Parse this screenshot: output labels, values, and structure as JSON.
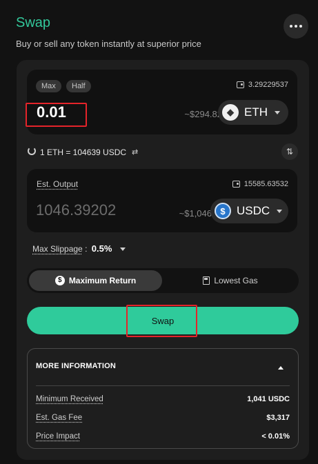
{
  "header": {
    "title": "Swap",
    "subtitle": "Buy or sell any token instantly at superior price"
  },
  "from": {
    "max_label": "Max",
    "half_label": "Half",
    "balance": "3.29229537",
    "amount": "0.01",
    "usd_value": "~$294.82",
    "token": "ETH"
  },
  "rate": {
    "text": "1 ETH = 104639 USDC"
  },
  "to": {
    "label": "Est. Output",
    "balance": "15585.63532",
    "amount": "1046.39202",
    "usd_value": "~$1,046",
    "token": "USDC"
  },
  "slippage": {
    "label": "Max Slippage",
    "separator": ":",
    "value": "0.5%"
  },
  "modes": [
    {
      "label": "Maximum Return",
      "active": true
    },
    {
      "label": "Lowest Gas",
      "active": false
    }
  ],
  "swap_button": "Swap",
  "more_info": {
    "title": "MORE INFORMATION",
    "rows": [
      {
        "label": "Minimum Received",
        "value": "1,041 USDC"
      },
      {
        "label": "Est. Gas Fee",
        "value": "$3,317"
      },
      {
        "label": "Price Impact",
        "value": "< 0.01%"
      }
    ]
  },
  "colors": {
    "accent": "#33c89b",
    "button": "#2fcb9b",
    "highlight": "#e5242a"
  }
}
